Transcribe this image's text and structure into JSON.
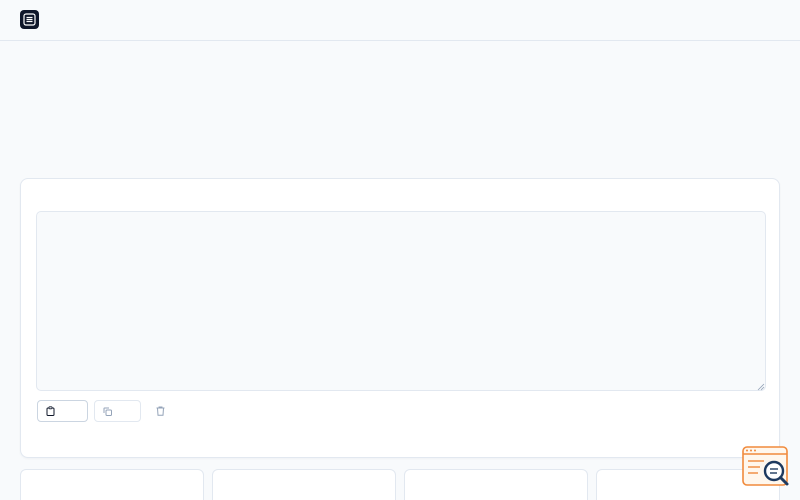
{
  "app": {
    "brand": "",
    "nav": [
      "",
      ""
    ]
  },
  "hero": {
    "title": "",
    "subtitle": "",
    "note": ""
  },
  "editor": {
    "label": "",
    "placeholder": "",
    "buttons": {
      "paste": "",
      "copy": "",
      "clear": ""
    }
  },
  "stats": [
    "",
    "",
    "",
    ""
  ],
  "colors": {
    "primary": "#0f172a",
    "background": "#f8fafc",
    "border": "#e2e8f0",
    "muted": "#64748b",
    "widget_accent": "#f08a3c"
  },
  "icons": {
    "logo": "document-lines-icon",
    "paste": "clipboard-icon",
    "copy": "copy-icon",
    "clear": "trash-icon",
    "widget": "search-doc-icon"
  }
}
